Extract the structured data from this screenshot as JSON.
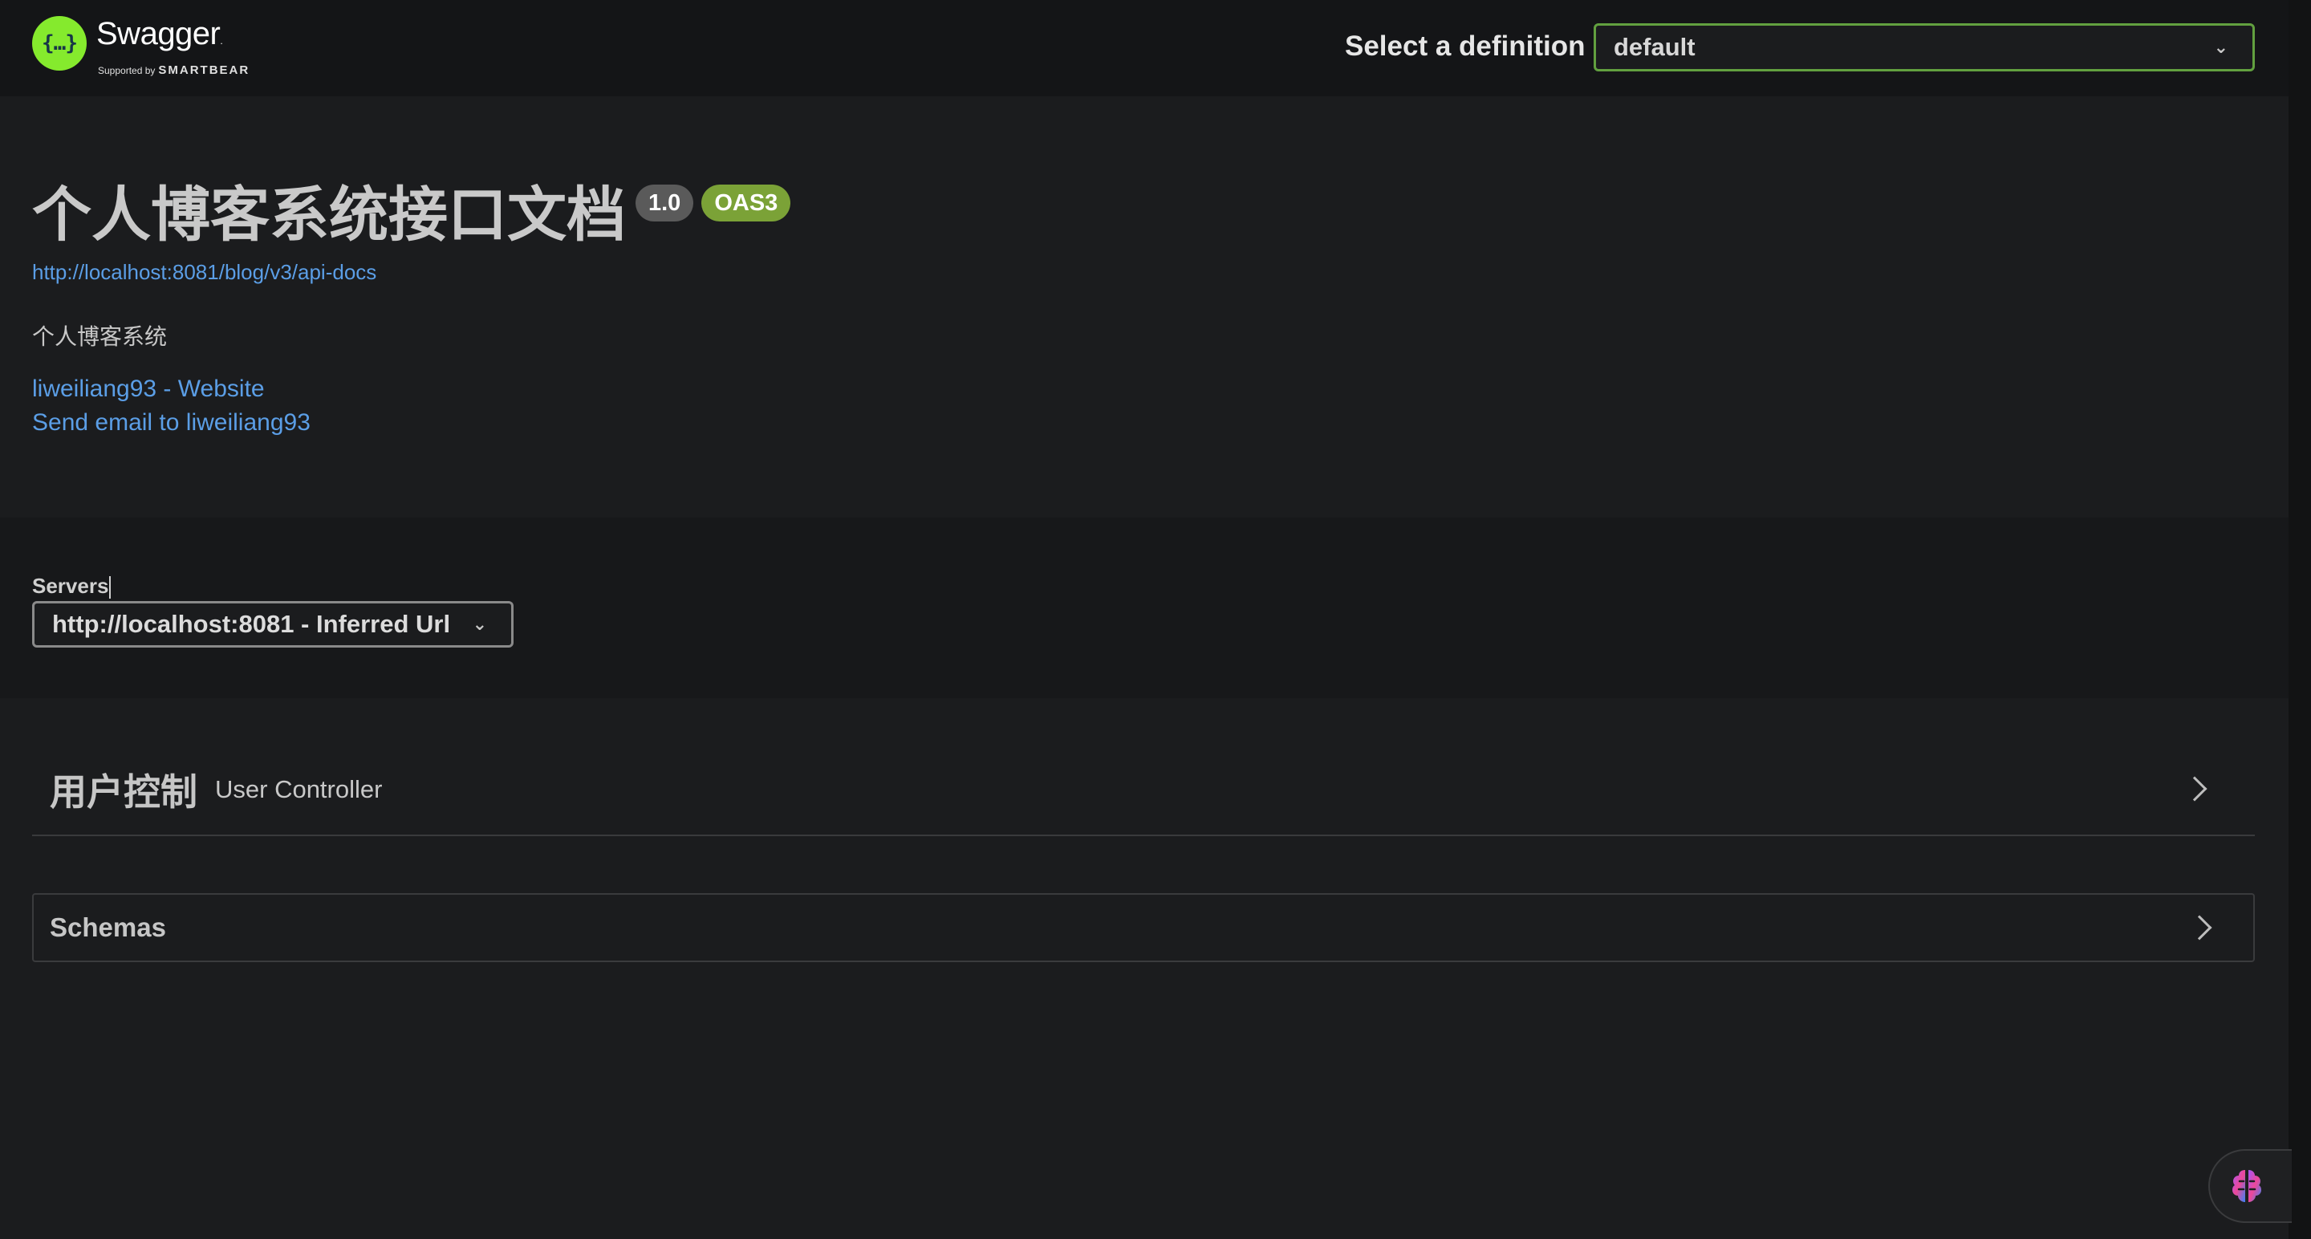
{
  "topbar": {
    "brand": "Swagger",
    "brand_sub_prefix": "Supported by",
    "brand_sub_company": "SMARTBEAR",
    "definition_label": "Select a definition",
    "definition_value": "default"
  },
  "info": {
    "title": "个人博客系统接口文档",
    "version_badge": "1.0",
    "oas_badge": "OAS3",
    "api_docs_url": "http://localhost:8081/blog/v3/api-docs",
    "description": "个人博客系统",
    "website_link": "liweiliang93 - Website",
    "email_link": "Send email to liweiliang93"
  },
  "servers": {
    "label": "Servers",
    "selected": "http://localhost:8081 - Inferred Url"
  },
  "tags": [
    {
      "name": "用户控制",
      "description": "User Controller"
    }
  ],
  "schemas": {
    "label": "Schemas"
  },
  "colors": {
    "background": "#1b1c1e",
    "topbar": "#141517",
    "link": "#5b9ee6",
    "swagger_green": "#85ea2d",
    "oas_badge": "#7ba237",
    "version_badge": "#5a5a5a",
    "definition_border": "#62a03f"
  },
  "icons": {
    "logo": "swagger-logo-icon",
    "dropdown": "chevron-down-icon",
    "expand": "chevron-right-icon",
    "assistant": "brain-icon"
  }
}
